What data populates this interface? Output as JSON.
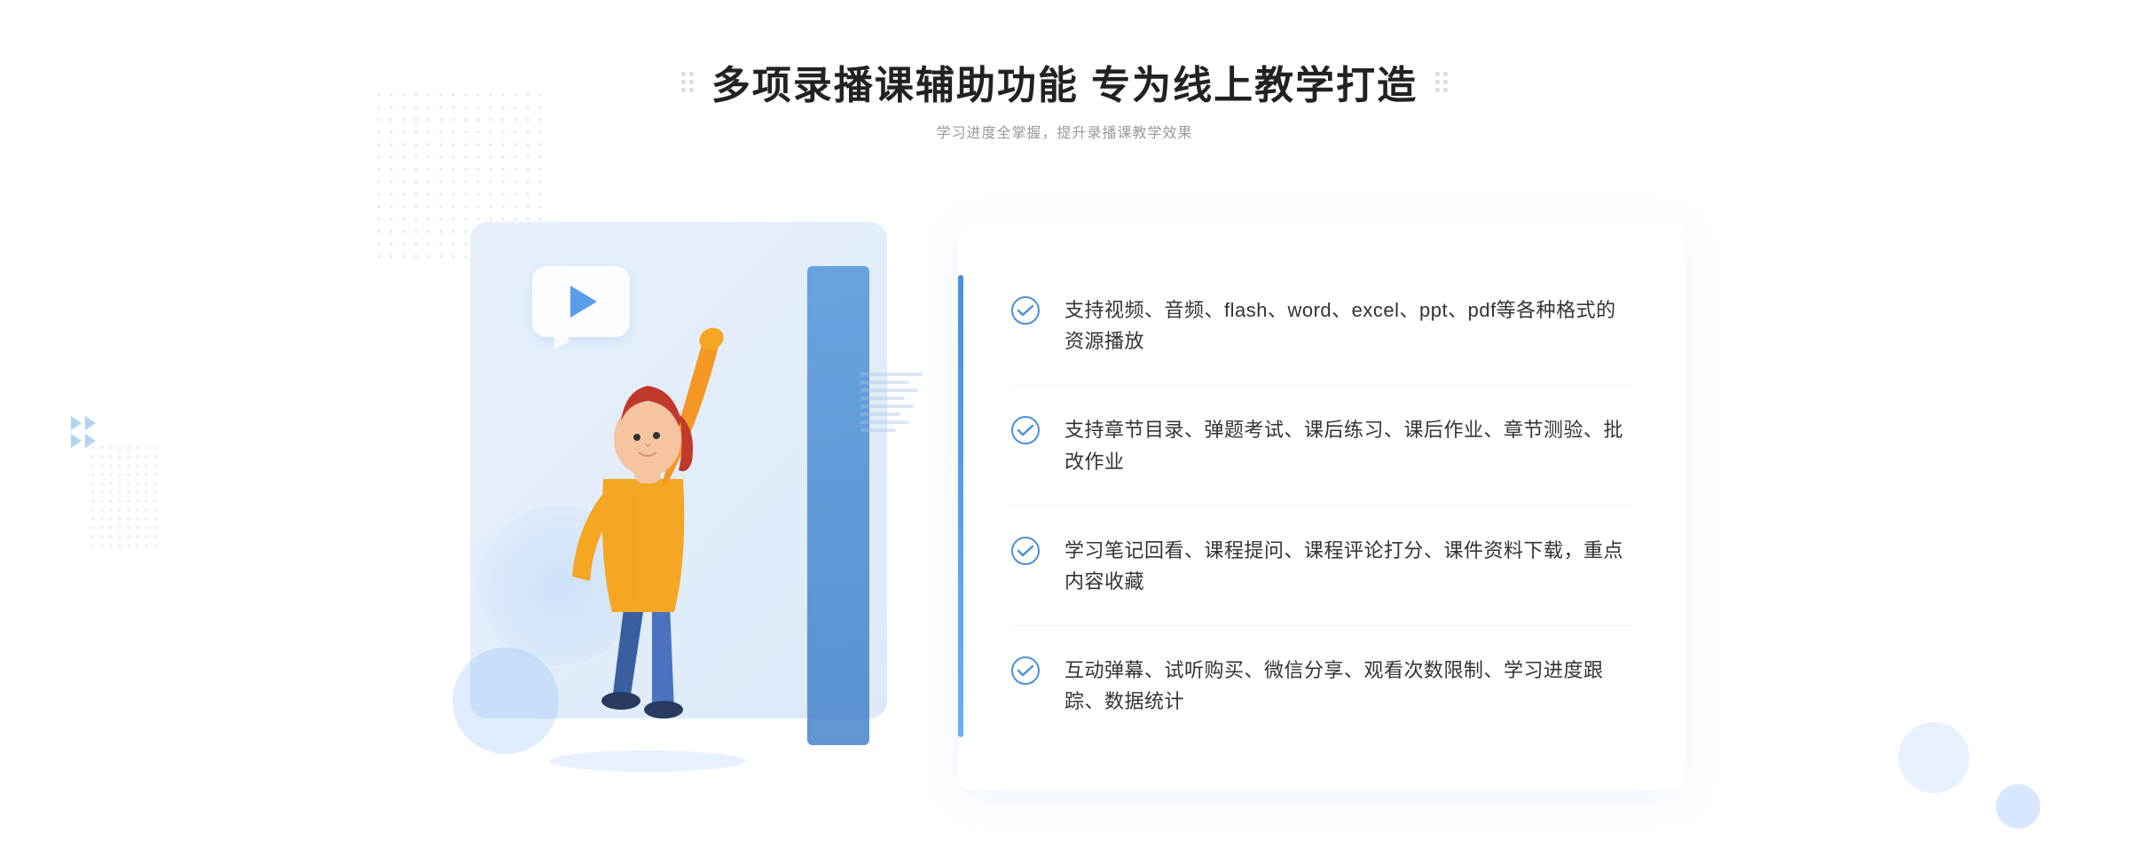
{
  "header": {
    "main_title": "多项录播课辅助功能 专为线上教学打造",
    "sub_title": "学习进度全掌握，提升录播课教学效果"
  },
  "features": [
    {
      "id": 1,
      "text": "支持视频、音频、flash、word、excel、ppt、pdf等各种格式的资源播放"
    },
    {
      "id": 2,
      "text": "支持章节目录、弹题考试、课后练习、课后作业、章节测验、批改作业"
    },
    {
      "id": 3,
      "text": "学习笔记回看、课程提问、课程评论打分、课件资料下载，重点内容收藏"
    },
    {
      "id": 4,
      "text": "互动弹幕、试听购买、微信分享、观看次数限制、学习进度跟踪、数据统计"
    }
  ],
  "colors": {
    "accent": "#4a90d9",
    "title": "#222222",
    "subtitle": "#999999",
    "text": "#333333",
    "check": "#4a90d9"
  }
}
